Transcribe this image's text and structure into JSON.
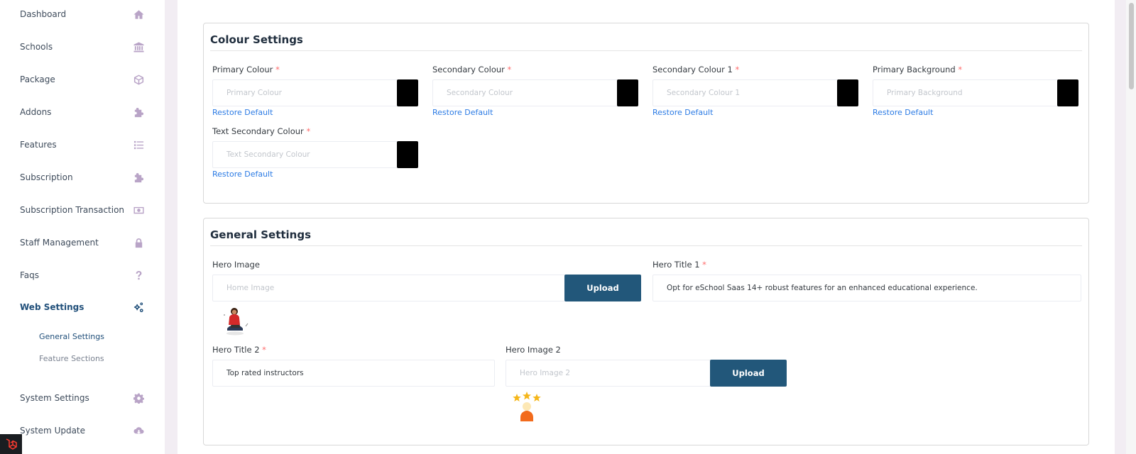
{
  "sidebar": {
    "items": [
      {
        "label": "Dashboard",
        "icon": "home-icon"
      },
      {
        "label": "Schools",
        "icon": "bank-icon"
      },
      {
        "label": "Package",
        "icon": "cube-icon"
      },
      {
        "label": "Addons",
        "icon": "puzzle-icon"
      },
      {
        "label": "Features",
        "icon": "list-icon"
      },
      {
        "label": "Subscription",
        "icon": "puzzle-icon"
      },
      {
        "label": "Subscription Transaction",
        "icon": "money-icon"
      },
      {
        "label": "Staff Management",
        "icon": "lock-icon"
      },
      {
        "label": "Faqs",
        "icon": "question-icon"
      },
      {
        "label": "Web Settings",
        "icon": "gears-icon",
        "active": true
      },
      {
        "label": "System Settings",
        "icon": "gear-icon"
      },
      {
        "label": "System Update",
        "icon": "cloud-download-icon"
      }
    ],
    "sub_items": [
      {
        "label": "General Settings",
        "active": true
      },
      {
        "label": "Feature Sections"
      }
    ]
  },
  "colour_settings": {
    "title": "Colour Settings",
    "required_mark": "*",
    "restore_label": "Restore Default",
    "fields": [
      {
        "label": "Primary Colour",
        "placeholder": "Primary Colour",
        "swatch": "#000000"
      },
      {
        "label": "Secondary Colour",
        "placeholder": "Secondary Colour",
        "swatch": "#000000"
      },
      {
        "label": "Secondary Colour 1",
        "placeholder": "Secondary Colour 1",
        "swatch": "#000000"
      },
      {
        "label": "Primary Background",
        "placeholder": "Primary Background",
        "swatch": "#000000"
      },
      {
        "label": "Text Secondary Colour",
        "placeholder": "Text Secondary Colour",
        "swatch": "#000000"
      }
    ]
  },
  "general_settings": {
    "title": "General Settings",
    "required_mark": "*",
    "hero_image": {
      "label": "Hero Image",
      "placeholder": "Home Image",
      "button": "Upload"
    },
    "hero_title_1": {
      "label": "Hero Title 1",
      "value": "Opt for eSchool Saas 14+ robust features for an enhanced educational experience."
    },
    "hero_title_2": {
      "label": "Hero Title 2",
      "value": "Top rated instructors"
    },
    "hero_image_2": {
      "label": "Hero Image 2",
      "placeholder": "Hero Image 2",
      "button": "Upload"
    }
  },
  "colors": {
    "accent": "#1f4e79",
    "upload_button": "#22577a",
    "link": "#2a7ae4",
    "required": "#ff6b6b",
    "sidebar_icon": "#b9a4c7"
  }
}
